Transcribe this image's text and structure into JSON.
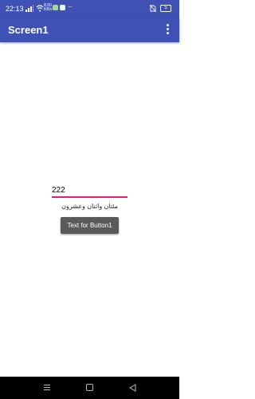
{
  "status_bar": {
    "time": "22:13",
    "speed_value": "8.00",
    "speed_unit": "KB/s",
    "more": "···",
    "battery": "5"
  },
  "app_bar": {
    "title": "Screen1",
    "menu_icon": "more-vert-icon"
  },
  "main": {
    "text_input_value": "222",
    "result_label": "مئتان واثنان وعشرون",
    "button_label": "Text for Button1"
  },
  "nav_bar": {
    "icons": [
      "menu-icon",
      "home-icon",
      "back-icon"
    ]
  },
  "colors": {
    "primary": "#3f51b5",
    "accent": "#e91e63",
    "button": "#5a5a5a"
  }
}
